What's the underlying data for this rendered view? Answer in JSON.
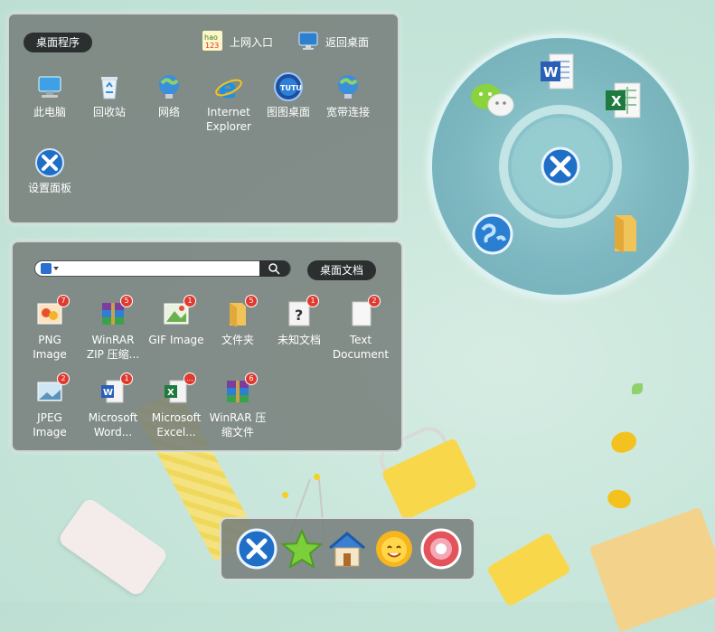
{
  "desktop_programs": {
    "title": "桌面程序",
    "links": [
      {
        "label": "上网入口",
        "icon": "hao123-icon"
      },
      {
        "label": "返回桌面",
        "icon": "monitor-icon"
      }
    ],
    "items": [
      {
        "label": "此电脑",
        "icon": "computer-icon"
      },
      {
        "label": "回收站",
        "icon": "recycle-bin-icon"
      },
      {
        "label": "网络",
        "icon": "network-icon"
      },
      {
        "label": "Internet Explorer",
        "icon": "ie-icon"
      },
      {
        "label": "图图桌面",
        "icon": "tutu-icon"
      },
      {
        "label": "宽带连接",
        "icon": "broadband-icon"
      },
      {
        "label": "设置面板",
        "icon": "settings-icon"
      }
    ]
  },
  "desktop_docs": {
    "title": "桌面文档",
    "search": {
      "placeholder": ""
    },
    "items": [
      {
        "label": "PNG Image",
        "badge": "7",
        "icon": "png-icon"
      },
      {
        "label": "WinRAR ZIP 压缩...",
        "badge": "5",
        "icon": "winrar-icon"
      },
      {
        "label": "GIF Image",
        "badge": "1",
        "icon": "gif-icon"
      },
      {
        "label": "文件夹",
        "badge": "5",
        "icon": "folder-icon"
      },
      {
        "label": "未知文档",
        "badge": "1",
        "icon": "unknown-file-icon"
      },
      {
        "label": "Text Document",
        "badge": "2",
        "icon": "text-file-icon"
      },
      {
        "label": "JPEG Image",
        "badge": "2",
        "icon": "jpeg-icon"
      },
      {
        "label": "Microsoft Word...",
        "badge": "1",
        "icon": "word-icon"
      },
      {
        "label": "Microsoft Excel...",
        "badge": "...",
        "icon": "excel-icon"
      },
      {
        "label": "WinRAR 压缩文件",
        "badge": "6",
        "icon": "winrar-icon"
      }
    ]
  },
  "ring_menu": {
    "items": [
      "wechat-icon",
      "word-icon",
      "excel-icon",
      "globe-icon",
      "folder-icon"
    ],
    "center": "tools-icon"
  },
  "dock": {
    "items": [
      "tools-icon",
      "star-icon",
      "house-icon",
      "sun-icon",
      "candy-icon"
    ]
  }
}
